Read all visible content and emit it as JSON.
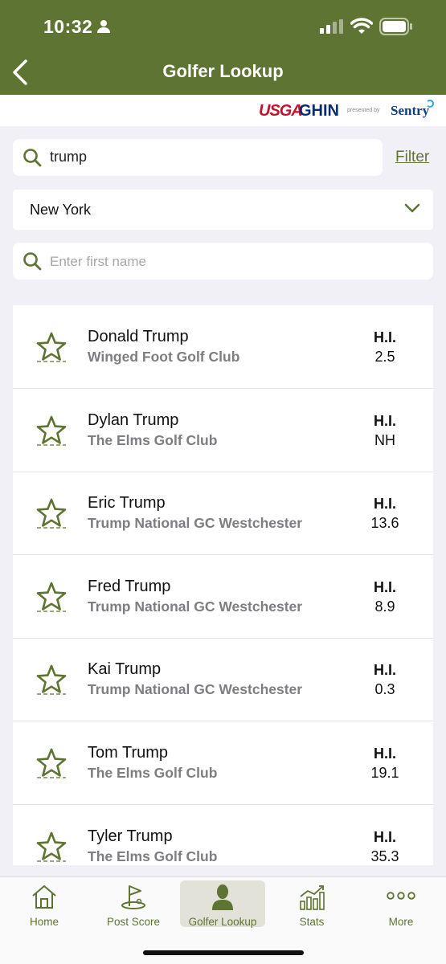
{
  "status": {
    "time": "10:32"
  },
  "header": {
    "title": "Golfer Lookup"
  },
  "brand": {
    "usga": "USGA",
    "ghin": "GHIN",
    "presented": "presented by",
    "sentry": "Sentry"
  },
  "search": {
    "value": "trump",
    "filter_label": "Filter"
  },
  "state_select": {
    "value": "New York"
  },
  "first_name": {
    "placeholder": "Enter first name"
  },
  "golfers": [
    {
      "name": "Donald Trump",
      "club": "Winged Foot Golf Club",
      "hi_label": "H.I.",
      "hi": "2.5"
    },
    {
      "name": "Dylan Trump",
      "club": "The Elms Golf Club",
      "hi_label": "H.I.",
      "hi": "NH"
    },
    {
      "name": "Eric Trump",
      "club": "Trump National GC Westchester",
      "hi_label": "H.I.",
      "hi": "13.6"
    },
    {
      "name": "Fred Trump",
      "club": "Trump National GC Westchester",
      "hi_label": "H.I.",
      "hi": "8.9"
    },
    {
      "name": "Kai Trump",
      "club": "Trump National GC Westchester",
      "hi_label": "H.I.",
      "hi": "0.3"
    },
    {
      "name": "Tom Trump",
      "club": "The Elms Golf Club",
      "hi_label": "H.I.",
      "hi": "19.1"
    },
    {
      "name": "Tyler Trump",
      "club": "The Elms Golf Club",
      "hi_label": "H.I.",
      "hi": "35.3"
    }
  ],
  "tabs": [
    {
      "label": "Home",
      "icon": "home-icon"
    },
    {
      "label": "Post Score",
      "icon": "golf-flag-icon"
    },
    {
      "label": "Golfer Lookup",
      "icon": "person-icon"
    },
    {
      "label": "Stats",
      "icon": "chart-icon"
    },
    {
      "label": "More",
      "icon": "more-icon"
    }
  ],
  "colors": {
    "brand_green": "#5d7432",
    "usga_red": "#c8102e",
    "ghin_navy": "#0a2d6e"
  }
}
